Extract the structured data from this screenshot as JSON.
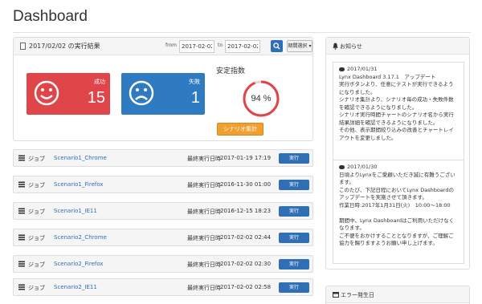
{
  "page": {
    "title": "Dashboard"
  },
  "result": {
    "title": "2017/02/02 の実行結果",
    "from_label": "from",
    "from_value": "2017-02-02",
    "to_label": "to",
    "to_value": "2017-02-02",
    "period_label": "期間選択",
    "success": {
      "label": "成功",
      "value": "15"
    },
    "fail": {
      "label": "失敗",
      "value": "1"
    },
    "stability_label": "安定指数",
    "stability_value": "94 %",
    "stability_level": 0.94,
    "scenario_button": "シナリオ集計",
    "colors": {
      "success": "#e0454a",
      "fail": "#2f7bc2",
      "gauge": "#e0454a",
      "accent": "#2f6fb5",
      "scenario_button": "#f0a030"
    }
  },
  "jobs": [
    {
      "job_label": "ジョブ",
      "name": "Scenario1_Chrome",
      "last_exec_label": "最終実行日時",
      "last_exec": "2017-01-19 17:19",
      "button": "実行"
    },
    {
      "job_label": "ジョブ",
      "name": "Scenario1_Firefox",
      "last_exec_label": "最終実行日時",
      "last_exec": "2016-11-30 01:00",
      "button": "実行"
    },
    {
      "job_label": "ジョブ",
      "name": "Scenario1_IE11",
      "last_exec_label": "最終実行日時",
      "last_exec": "2016-12-15 18:23",
      "button": "実行"
    },
    {
      "job_label": "ジョブ",
      "name": "Scenario2_Chrome",
      "last_exec_label": "最終実行日時",
      "last_exec": "2017-02-02 02:44",
      "button": "実行"
    },
    {
      "job_label": "ジョブ",
      "name": "Scenario2_Firefox",
      "last_exec_label": "最終実行日時",
      "last_exec": "2017-02-02 02:30",
      "button": "実行"
    },
    {
      "job_label": "ジョブ",
      "name": "Scenario2_IE11",
      "last_exec_label": "最終実行日時",
      "last_exec": "2017-02-02 02:58",
      "button": "実行"
    }
  ],
  "notices": {
    "title": "お知らせ",
    "items": [
      {
        "date": "2017/01/31",
        "body": "Lynx Dashboard 3.17.1　アップデート\n実行ボタンより、任意にテストが実行できるようになりました。\nシナリオ集計より、シナリオ毎の成功・失敗件数を確認できるようになりました。\nシナリオ実行時間チャートのシナリオ名から実行結果詳細を確認できるようになりました。\nその他、表示期間絞り込みの改善とチャートレイアウトを変更しました。"
      },
      {
        "date": "2017/01/30",
        "body": "日頃よりLynxをご愛顧いただき誠に有難うございます。\nこのたび、下記日程においてLynx Dashboardのアップデートを実施させて頂きます。\n作業日時:2017年1月31日(火)　10:00〜18:00\n\n期間中、Lynx Dashboardはご利用いただけなくなります。\nご不便をおかけすることとなりますが、ご理解ご協力を賜りますようお願い申し上げます。"
      }
    ]
  },
  "errors": {
    "title": "エラー発生日"
  }
}
